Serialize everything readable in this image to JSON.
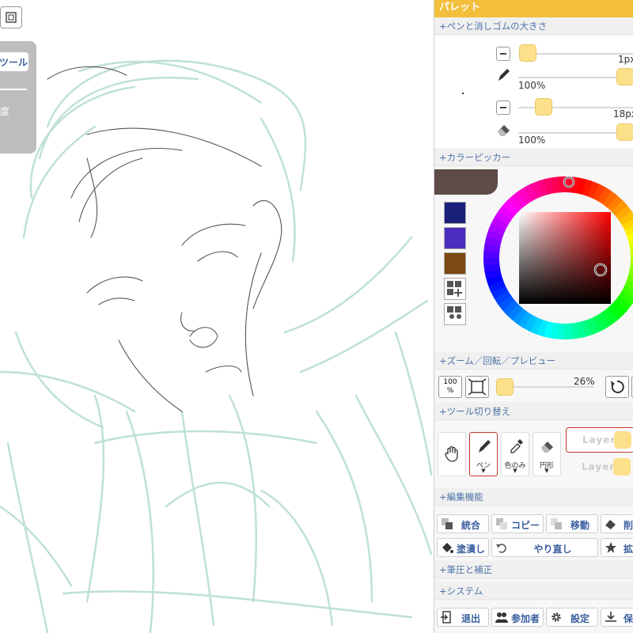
{
  "canvas": {
    "tool_popup": {
      "tab_label": "ツール",
      "sub_label": "度"
    }
  },
  "palette": {
    "title": "パレット",
    "sections": {
      "pen_eraser_size": "+ペンと消しゴムの大きさ",
      "color_picker": "+カラーピッカー",
      "zoom": "+ズーム／回転／プレビュー",
      "tool_switch": "+ツール切り替え",
      "edit": "+編集機能",
      "pressure": "+筆圧と補正",
      "system": "+システム"
    },
    "pen": {
      "size": "1px",
      "opacity": "100%",
      "size_level": 0.01,
      "opacity_level": 1.0
    },
    "eraser": {
      "size": "18px",
      "opacity": "100%",
      "size_level": 0.18,
      "opacity_level": 1.0
    },
    "colors": {
      "current": "#5e4b48",
      "swatches": [
        "#1a1f7a",
        "#4b2dbf",
        "#7a4a12"
      ],
      "wheel_hue_marker": "red",
      "picked": "#3a2a2a"
    },
    "zoom": {
      "fit_label": "100 %",
      "value": "26%",
      "level": 0.26
    },
    "tools": [
      {
        "label": "",
        "icon": "hand-icon"
      },
      {
        "label": "ペン",
        "icon": "pen-icon",
        "selected": true
      },
      {
        "label": "色のみ",
        "icon": "eyedropper-icon"
      },
      {
        "label": "円形",
        "icon": "eraser-icon"
      }
    ],
    "layers": [
      "Layer1",
      "Layer2"
    ],
    "edit_buttons": [
      {
        "label": "統合",
        "icon": "merge-icon"
      },
      {
        "label": "コピー",
        "icon": "copy-icon"
      },
      {
        "label": "移動",
        "icon": "move-icon"
      },
      {
        "label": "削",
        "icon": "clear-icon"
      },
      {
        "label": "塗潰し",
        "icon": "bucket-icon"
      },
      {
        "label": "やり直し",
        "icon": "redo-icon"
      },
      {
        "label": "拡",
        "icon": "star-icon"
      }
    ],
    "system_buttons": [
      {
        "label": "退出",
        "icon": "exit-icon"
      },
      {
        "label": "参加者",
        "icon": "people-icon"
      },
      {
        "label": "設定",
        "icon": "gear-icon"
      },
      {
        "label": "保",
        "icon": "download-icon"
      }
    ]
  }
}
